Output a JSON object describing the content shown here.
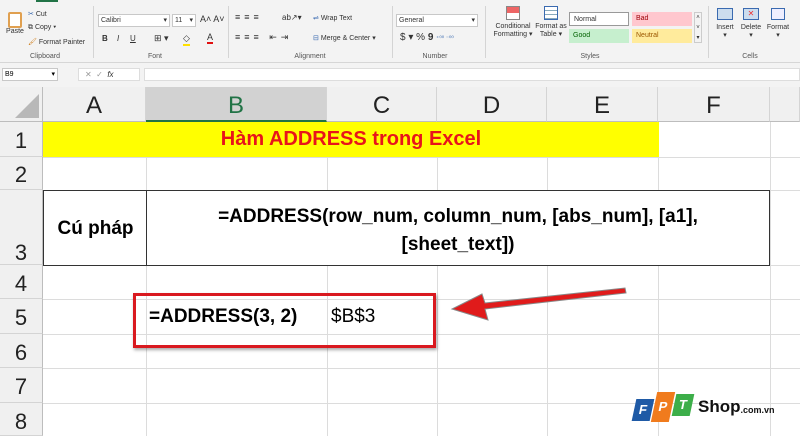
{
  "ribbon": {
    "clipboard": {
      "paste": "Paste",
      "cut": "Cut",
      "copy": "Copy",
      "format_painter": "Format Painter",
      "label": "Clipboard"
    },
    "font": {
      "name": "Calibri",
      "size": "11",
      "bold": "B",
      "italic": "I",
      "underline": "U",
      "label": "Font"
    },
    "alignment": {
      "wrap_text": "Wrap Text",
      "merge_center": "Merge & Center",
      "label": "Alignment"
    },
    "number": {
      "format": "General",
      "currency": "$",
      "percent": "%",
      "comma": "9",
      "label": "Number"
    },
    "styles": {
      "conditional": "Conditional Formatting",
      "format_table": "Format as Table",
      "normal": "Normal",
      "bad": "Bad",
      "good": "Good",
      "neutral": "Neutral",
      "label": "Styles"
    },
    "cells": {
      "insert": "Insert",
      "delete": "Delete",
      "format": "Format",
      "label": "Cells"
    }
  },
  "formula_bar": {
    "name_box": "B9",
    "fx": "fx",
    "value": ""
  },
  "columns": [
    "A",
    "B",
    "C",
    "D",
    "E",
    "F"
  ],
  "rows": [
    "1",
    "2",
    "3",
    "4",
    "5",
    "6",
    "7",
    "8"
  ],
  "cells": {
    "title": "Hàm ADDRESS trong Excel",
    "syntax_label": "Cú pháp",
    "syntax_line1": "=ADDRESS(row_num, column_num, [abs_num], [a1],",
    "syntax_line2": "[sheet_text])",
    "example_formula": "=ADDRESS(3, 2)",
    "example_result": "$B$3"
  },
  "logo": {
    "brand": "FPT",
    "shop": "Shop",
    ".com.vn": ".com.vn",
    "suffix": ".com.vn"
  },
  "colors": {
    "title_bg": "#ffff00",
    "title_text": "#e8141b",
    "highlight": "#d9191f",
    "excel_green": "#217346"
  }
}
